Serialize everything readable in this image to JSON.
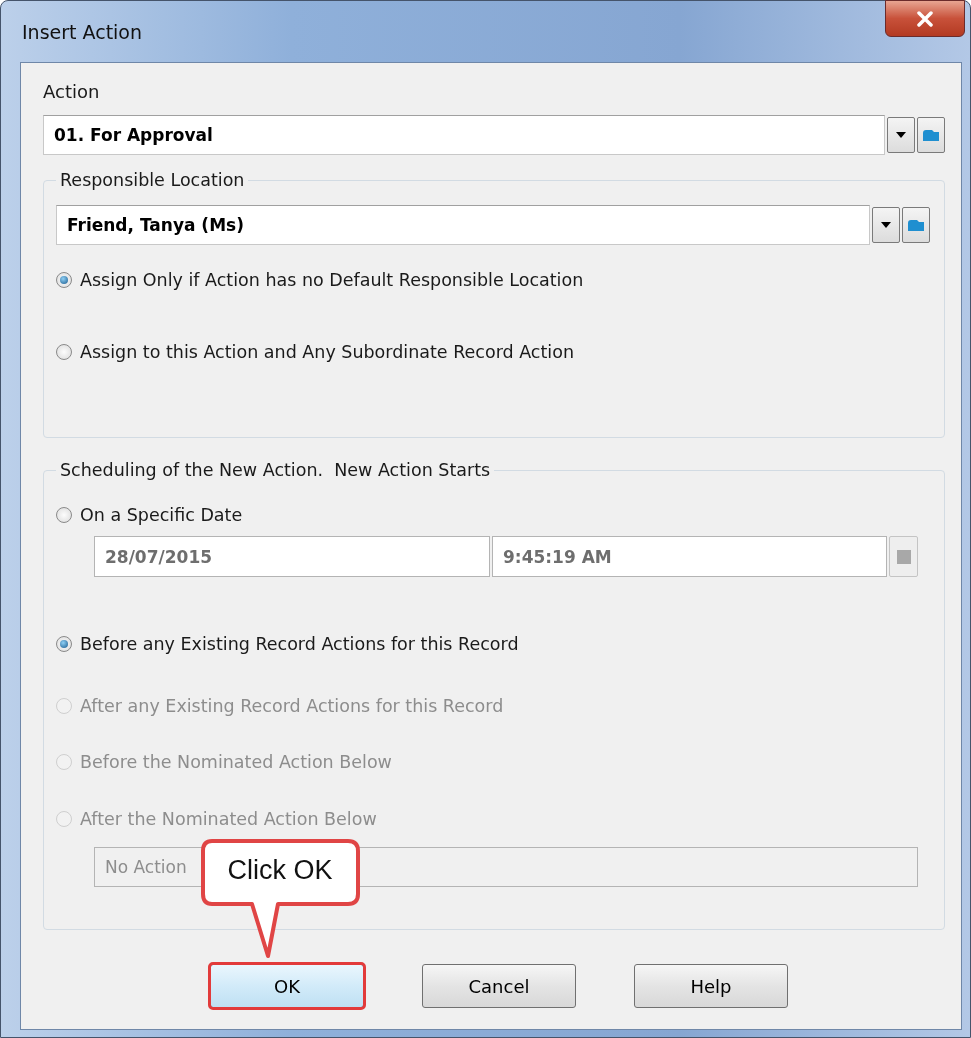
{
  "window": {
    "title": "Insert Action"
  },
  "action": {
    "label": "Action",
    "value": "01. For Approval"
  },
  "responsible_location": {
    "legend": "Responsible Location",
    "value": "Friend, Tanya (Ms)",
    "options": [
      {
        "label": "Assign Only if Action has no Default Responsible Location",
        "selected": true,
        "disabled": false
      },
      {
        "label": "Assign to this Action and Any Subordinate Record Action",
        "selected": false,
        "disabled": false
      }
    ]
  },
  "scheduling": {
    "legend": "Scheduling of the New Action.  New Action Starts",
    "options": [
      {
        "label": "On a Specific Date",
        "selected": false,
        "disabled": false
      },
      {
        "label": "Before any Existing Record Actions for this Record",
        "selected": true,
        "disabled": false
      },
      {
        "label": "After any Existing Record Actions for this Record",
        "selected": false,
        "disabled": true
      },
      {
        "label": "Before the Nominated Action Below",
        "selected": false,
        "disabled": true
      },
      {
        "label": "After the Nominated Action Below",
        "selected": false,
        "disabled": true
      }
    ],
    "date": "28/07/2015",
    "time": "9:45:19 AM",
    "nominated_action": "No Action"
  },
  "buttons": [
    {
      "label": "OK",
      "highlighted": true
    },
    {
      "label": "Cancel",
      "highlighted": false
    },
    {
      "label": "Help",
      "highlighted": false
    }
  ],
  "callout": {
    "text": "Click OK"
  }
}
